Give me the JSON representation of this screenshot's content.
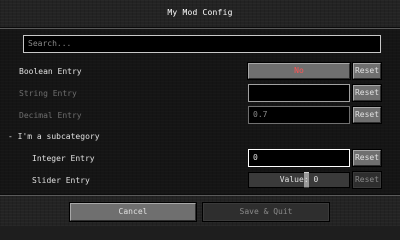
{
  "window": {
    "title": "My Mod Config"
  },
  "search": {
    "placeholder": "Search..."
  },
  "entries": {
    "boolean": {
      "label": "Boolean Entry",
      "value": "No",
      "value_color": "#ff5555",
      "reset": "Reset"
    },
    "string": {
      "label": "String Entry",
      "value": "",
      "reset": "Reset"
    },
    "decimal": {
      "label": "Decimal Entry",
      "value": "0.7",
      "reset": "Reset"
    },
    "subcategory": {
      "label": "- I'm a subcategory"
    },
    "integer": {
      "label": "Integer Entry",
      "value": "0",
      "reset": "Reset"
    },
    "slider": {
      "label": "Slider Entry",
      "value_text": "Value: 0",
      "reset": "Reset"
    }
  },
  "footer": {
    "cancel": "Cancel",
    "save": "Save & Quit"
  }
}
